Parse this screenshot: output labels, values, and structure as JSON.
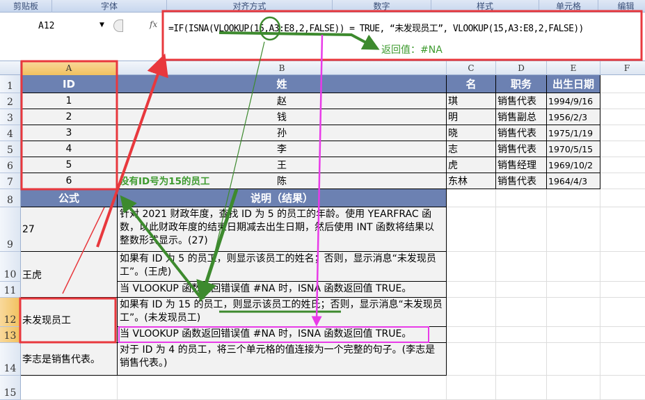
{
  "ribbon": {
    "groups": [
      "剪贴板",
      "字体",
      "对齐方式",
      "数字",
      "样式",
      "单元格",
      "编辑"
    ]
  },
  "formula_bar": {
    "name_box": "A12",
    "fx_label": "fx",
    "formula": "=IF(ISNA(VLOOKUP(15,A3:E8,2,FALSE)) = TRUE, “未发现员工”, VLOOKUP(15,A3:E8,2,FALSE))"
  },
  "columns": [
    "A",
    "B",
    "C",
    "D",
    "E",
    "F"
  ],
  "row_numbers": [
    "1",
    "2",
    "3",
    "4",
    "5",
    "6",
    "7",
    "8",
    "9",
    "10",
    "11",
    "12",
    "13",
    "14",
    "15"
  ],
  "table": {
    "headers": [
      "ID",
      "姓",
      "名",
      "职务",
      "出生日期"
    ],
    "rows": [
      [
        "1",
        "赵",
        "琪",
        "销售代表",
        "1994/9/16"
      ],
      [
        "2",
        "钱",
        "明",
        "销售副总",
        "1956/2/3"
      ],
      [
        "3",
        "孙",
        "晓",
        "销售代表",
        "1975/1/19"
      ],
      [
        "4",
        "李",
        "志",
        "销售代表",
        "1970/5/15"
      ],
      [
        "5",
        "王",
        "虎",
        "销售经理",
        "1969/10/2"
      ],
      [
        "6",
        "陈",
        "东林",
        "销售代表",
        "1964/4/3"
      ]
    ]
  },
  "formulas": {
    "headers": [
      "公式",
      "说明（结果）"
    ],
    "a9": "27",
    "b9": "针对 2021 财政年度，查找 ID 为 5 的员工的年龄。使用 YEARFRAC 函数，以此财政年度的结束日期减去出生日期，然后使用 INT 函数将结果以整数形式显示。(27)",
    "a10": "王虎",
    "b10": "如果有 ID 为 5 的员工，则显示该员工的姓名；否则，显示消息“未发现员工”。(王虎)",
    "b11": "当 VLOOKUP 函数返回错误值 #NA 时，ISNA 函数返回值 TRUE。",
    "a12": "未发现员工",
    "b12": "如果有 ID 为 15 的员工，则显示该员工的姓氏；否则，显示消息“未发现员工”。(未发现员工)",
    "b13": "当 VLOOKUP 函数返回错误值 #NA 时，ISNA 函数返回值 TRUE。",
    "a14": "李志是销售代表。",
    "b14": "对于 ID 为 4 的员工，将三个单元格的值连接为一个完整的句子。(李志是销售代表。)"
  },
  "annotations": {
    "return_value": "返回值：#NA",
    "no_id": "没有ID号为15的员工"
  },
  "colors": {
    "header": "#6c81b2",
    "red": "#e8383d",
    "green": "#3d8a2e",
    "magenta": "#e83be8"
  }
}
